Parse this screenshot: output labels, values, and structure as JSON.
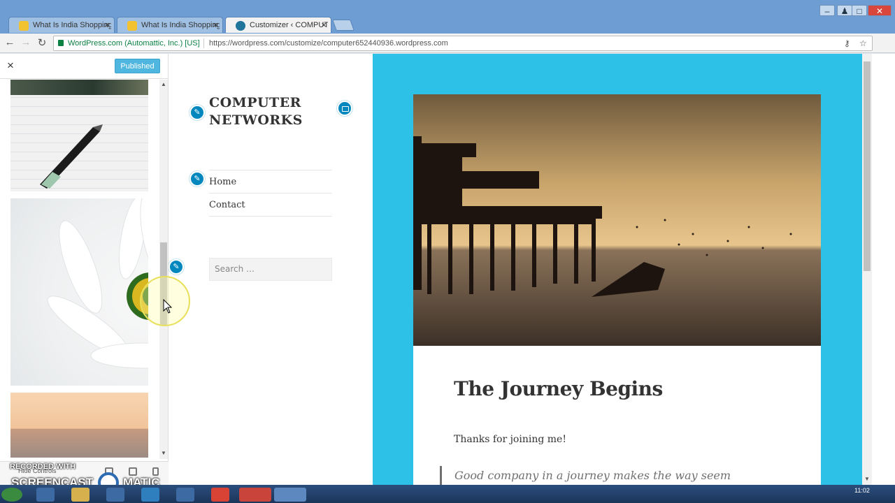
{
  "browser": {
    "tabs": [
      {
        "title": "What Is India Shopping",
        "active": false,
        "icon": "norton-icon"
      },
      {
        "title": "What Is India Shopping",
        "active": false,
        "icon": "norton-icon"
      },
      {
        "title": "Customizer ‹ COMPUTER",
        "active": true,
        "icon": "wordpress-icon"
      }
    ],
    "site_identity": "WordPress.com (Automattic, Inc.) [US]",
    "url": "https://wordpress.com/customize/computer652440936.wordpress.com"
  },
  "customizer": {
    "close_icon": "×",
    "publish_label": "Published",
    "footer": {
      "hide_controls_label": "Hide Controls"
    }
  },
  "site": {
    "title": "COMPUTER NETWORKS",
    "menu": [
      "Home",
      "Contact"
    ],
    "search_placeholder": "Search …"
  },
  "post": {
    "title": "The Journey Begins",
    "body": "Thanks for joining me!",
    "quote": "Good company in a journey makes the way seem"
  },
  "watermark": {
    "recorded": "RECORDED WITH",
    "brand_left": "SCREENCAST",
    "brand_right": "MATIC"
  },
  "taskbar": {
    "clock": "11:02"
  },
  "colors": {
    "accent": "#0087be",
    "preview_background": "#2dc1e8",
    "publish_button": "#4fb6e0"
  }
}
